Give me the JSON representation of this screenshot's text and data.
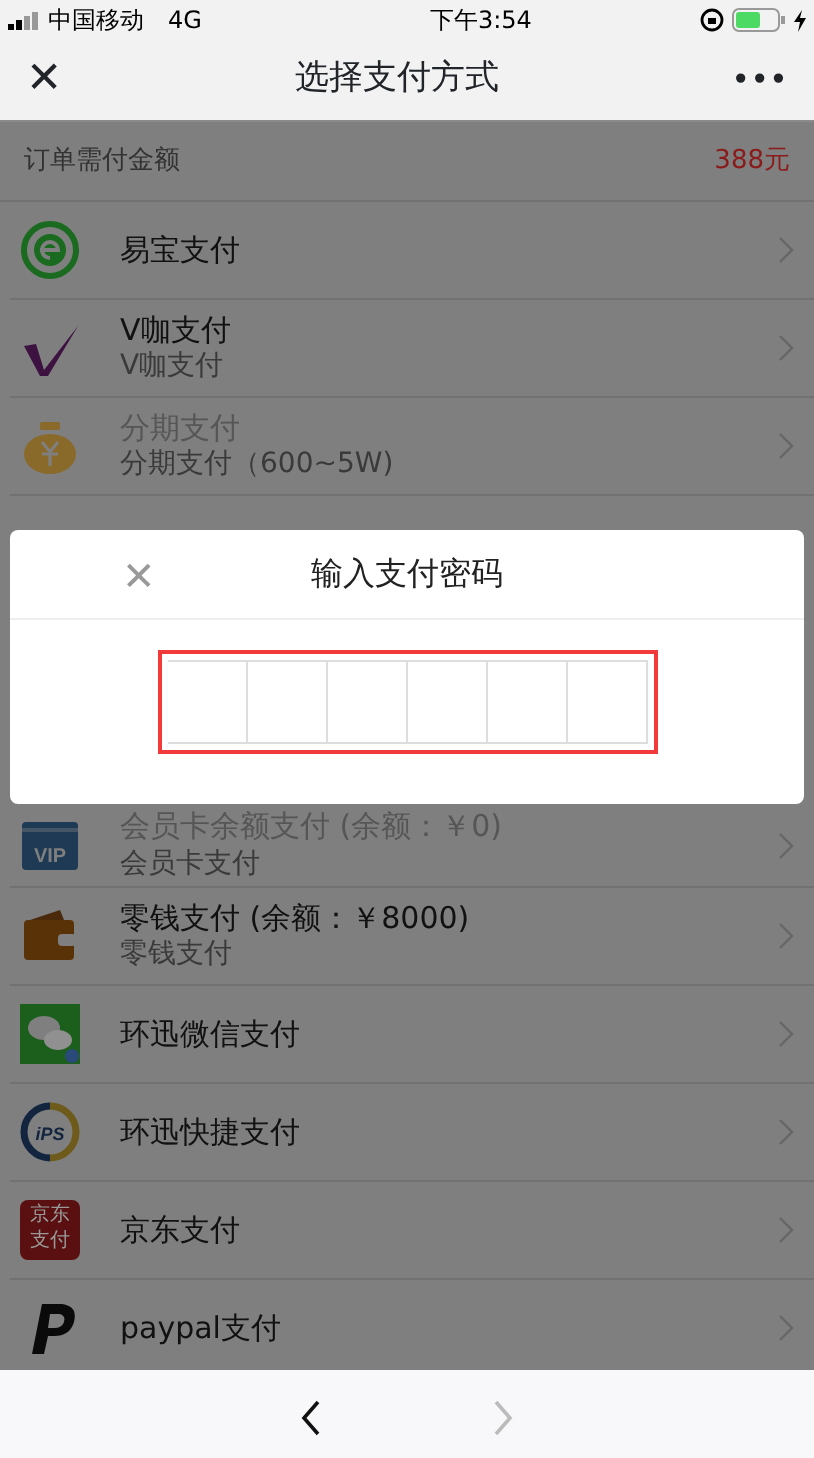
{
  "status_bar": {
    "carrier": "中国移动",
    "network": "4G",
    "time": "下午3:54"
  },
  "nav": {
    "close": "✕",
    "title": "选择支付方式",
    "more": "•••"
  },
  "order": {
    "label": "订单需付金额",
    "amount": "388元"
  },
  "methods_top": [
    {
      "kind": "yeepay",
      "title": "易宝支付",
      "disabled": false
    },
    {
      "kind": "vcoffee",
      "title": "V咖支付",
      "subtitle": "V咖支付",
      "disabled": false
    },
    {
      "kind": "installment",
      "title": "分期支付",
      "subtitle": "分期支付（600~5W)",
      "disabled": true
    }
  ],
  "methods_bottom": [
    {
      "kind": "vip",
      "icon_text": "VIP",
      "title": "会员卡余额支付 (余额：￥0)",
      "subtitle": "会员卡支付",
      "disabled": true
    },
    {
      "kind": "wallet",
      "title": "零钱支付 (余额：￥8000)",
      "subtitle": "零钱支付",
      "disabled": false
    },
    {
      "kind": "wechat",
      "title": "环迅微信支付",
      "disabled": false
    },
    {
      "kind": "ips",
      "icon_text": "iPS",
      "title": "环迅快捷支付",
      "disabled": false
    },
    {
      "kind": "jd",
      "icon_text": "京东支付",
      "title": "京东支付",
      "disabled": false
    },
    {
      "kind": "paypal",
      "title": "paypal支付",
      "disabled": false
    }
  ],
  "dialog": {
    "close": "✕",
    "title": "输入支付密码",
    "password_highlighted": true
  },
  "toolbar": [
    {
      "kind": "back",
      "disabled": false
    },
    {
      "kind": "forward",
      "disabled": true
    }
  ]
}
